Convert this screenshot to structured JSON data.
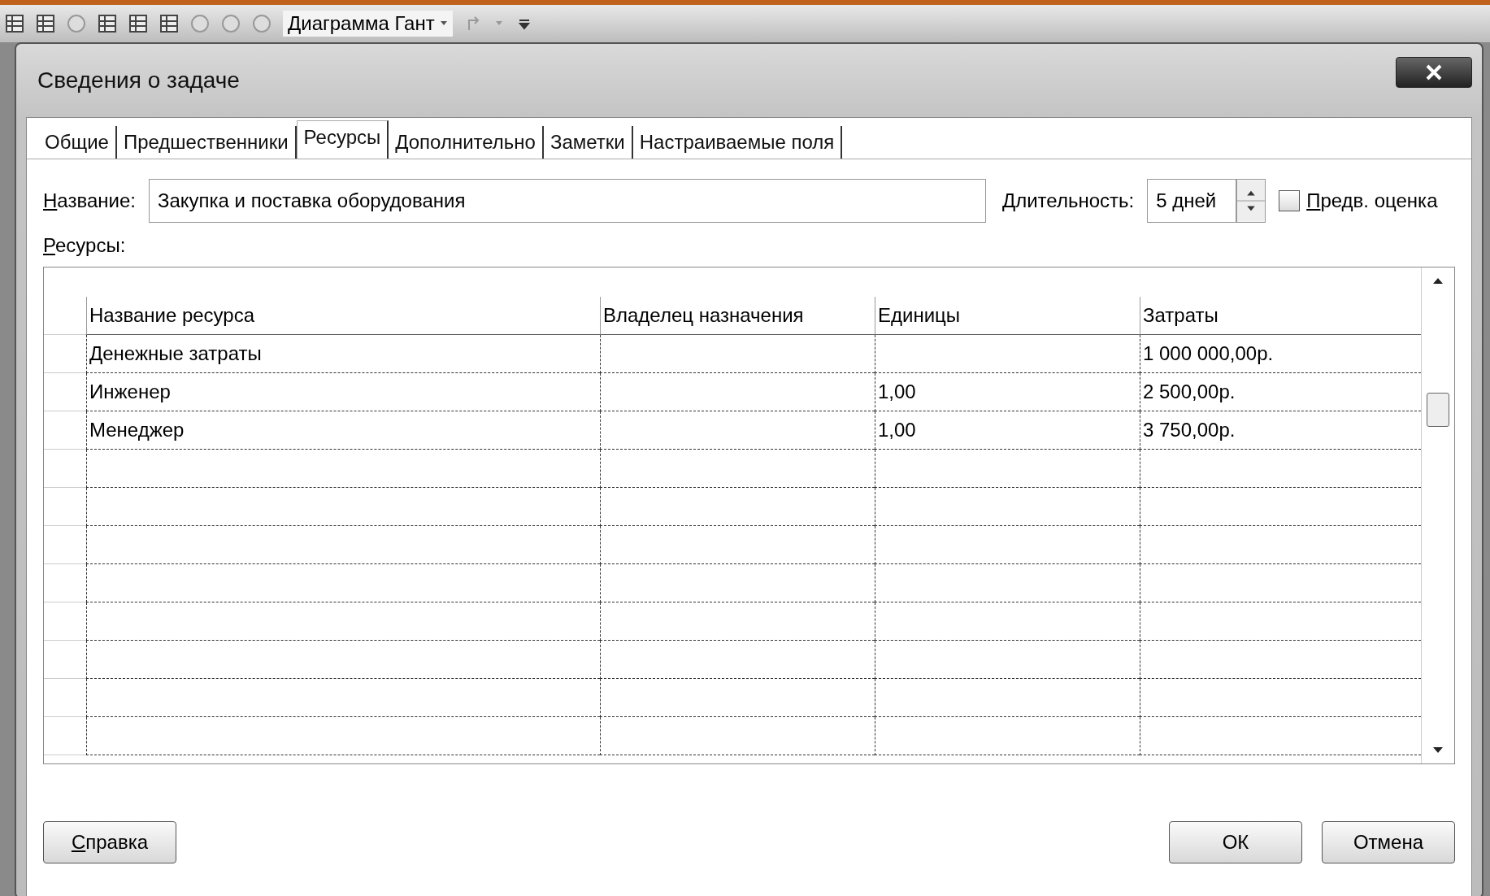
{
  "toolbar": {
    "view_selector": "Диаграмма Гант"
  },
  "dialog": {
    "title": "Сведения о задаче",
    "tabs": [
      {
        "label": "Общие",
        "selected": false
      },
      {
        "label": "Предшественники",
        "selected": false
      },
      {
        "label": "Ресурсы",
        "selected": true
      },
      {
        "label": "Дополнительно",
        "selected": false
      },
      {
        "label": "Заметки",
        "selected": false
      },
      {
        "label": "Настраиваемые поля",
        "selected": false
      }
    ],
    "name_label": "Название:",
    "name_value": "Закупка и поставка оборудования",
    "duration_label": "Длительность:",
    "duration_value": "5 дней",
    "estimate": {
      "label": "Предв. оценка",
      "checked": false
    },
    "resources_label": "Ресурсы:",
    "table": {
      "columns": [
        "Название ресурса",
        "Владелец назначения",
        "Единицы",
        "Затраты"
      ],
      "rows": [
        [
          "Денежные затраты",
          "",
          "",
          "1 000 000,00р."
        ],
        [
          "Инженер",
          "",
          "1,00",
          "2 500,00р."
        ],
        [
          "Менеджер",
          "",
          "1,00",
          "3 750,00р."
        ]
      ]
    },
    "buttons": {
      "help": "Справка",
      "ok": "ОК",
      "cancel": "Отмена"
    }
  }
}
